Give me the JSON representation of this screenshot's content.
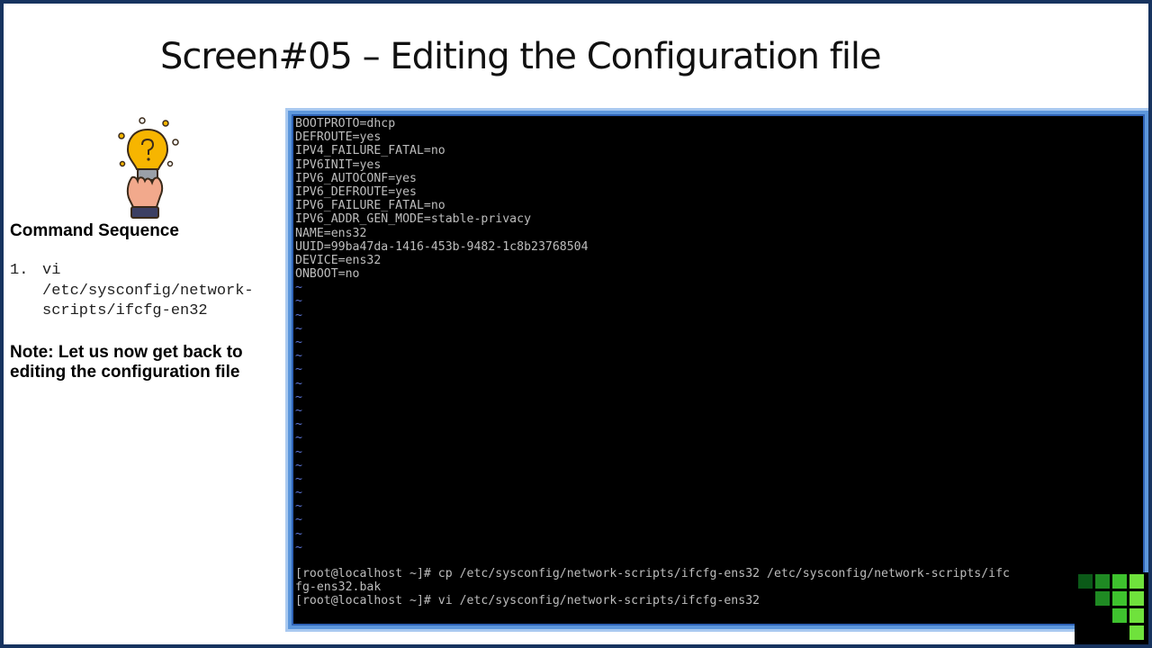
{
  "slide": {
    "title": "Screen#05 – Editing the Configuration file",
    "section_heading": "Command Sequence",
    "commands": [
      {
        "number": "1.",
        "text": "vi\n/etc/sysconfig/network-\nscripts/ifcfg-en32"
      }
    ],
    "note": "Note: Let us now get back to editing the configuration file",
    "illustration": "hand-holding-lightbulb-icon"
  },
  "terminal": {
    "config_lines": [
      "BOOTPROTO=dhcp",
      "DEFROUTE=yes",
      "IPV4_FAILURE_FATAL=no",
      "IPV6INIT=yes",
      "IPV6_AUTOCONF=yes",
      "IPV6_DEFROUTE=yes",
      "IPV6_FAILURE_FATAL=no",
      "IPV6_ADDR_GEN_MODE=stable-privacy",
      "NAME=ens32",
      "UUID=99ba47da-1416-453b-9482-1c8b23768504",
      "DEVICE=ens32",
      "ONBOOT=no"
    ],
    "empty_line_marker": "~",
    "empty_line_count": 20,
    "shell_lines": [
      "[root@localhost ~]# cp /etc/sysconfig/network-scripts/ifcfg-ens32 /etc/sysconfig/network-scripts/ifc",
      "fg-ens32.bak",
      "[root@localhost ~]# vi /etc/sysconfig/network-scripts/ifcfg-ens32"
    ],
    "text_color": "#bdbdbd",
    "tilde_color": "#5a74d6"
  },
  "colors": {
    "slide_border": "#17335f",
    "terminal_frame": "#5d97dc",
    "logo_greens": [
      "#0b5a18",
      "#1f8a23",
      "#3ec22e",
      "#6fe23c"
    ]
  },
  "logo": {
    "name": "green-squares-logo-icon"
  }
}
